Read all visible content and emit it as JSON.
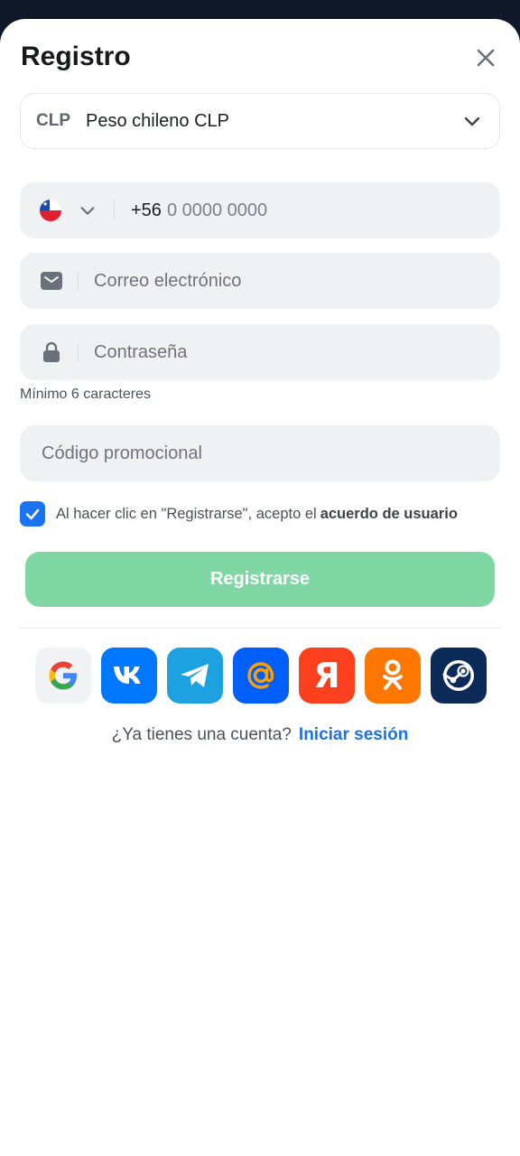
{
  "header": {
    "title": "Registro"
  },
  "currency": {
    "code": "CLP",
    "name": "Peso chileno CLP"
  },
  "phone": {
    "country": "Chile",
    "prefix": "+56",
    "placeholder": "0 0000 0000"
  },
  "email": {
    "placeholder": "Correo electrónico"
  },
  "password": {
    "placeholder": "Contraseña",
    "hint": "Mínimo 6 caracteres"
  },
  "promo": {
    "placeholder": "Código promocional"
  },
  "agreement": {
    "checked": true,
    "text": "Al hacer clic en \"Registrarse\", acepto el",
    "link": "acuerdo de usuario"
  },
  "submit": {
    "label": "Registrarse"
  },
  "socials": [
    {
      "name": "google",
      "icon": "google-icon",
      "color": "#f1f2f4"
    },
    {
      "name": "vk",
      "icon": "vk-icon",
      "color": "#0077ff"
    },
    {
      "name": "telegram",
      "icon": "telegram-icon",
      "color": "#1da1e0"
    },
    {
      "name": "mail",
      "icon": "at-icon",
      "color": "#005ff9"
    },
    {
      "name": "yandex",
      "icon": "yandex-icon",
      "color": "#fc3f1d"
    },
    {
      "name": "odnoklassniki",
      "icon": "ok-icon",
      "color": "#ff7700"
    },
    {
      "name": "steam",
      "icon": "steam-icon",
      "color": "#0b2a57"
    }
  ],
  "footer": {
    "question": "¿Ya tienes una cuenta?",
    "login": "Iniciar sesión"
  },
  "colors": {
    "accent": "#1a73f0",
    "submit_disabled": "#7fd8a4",
    "link": "#1a73e8"
  }
}
